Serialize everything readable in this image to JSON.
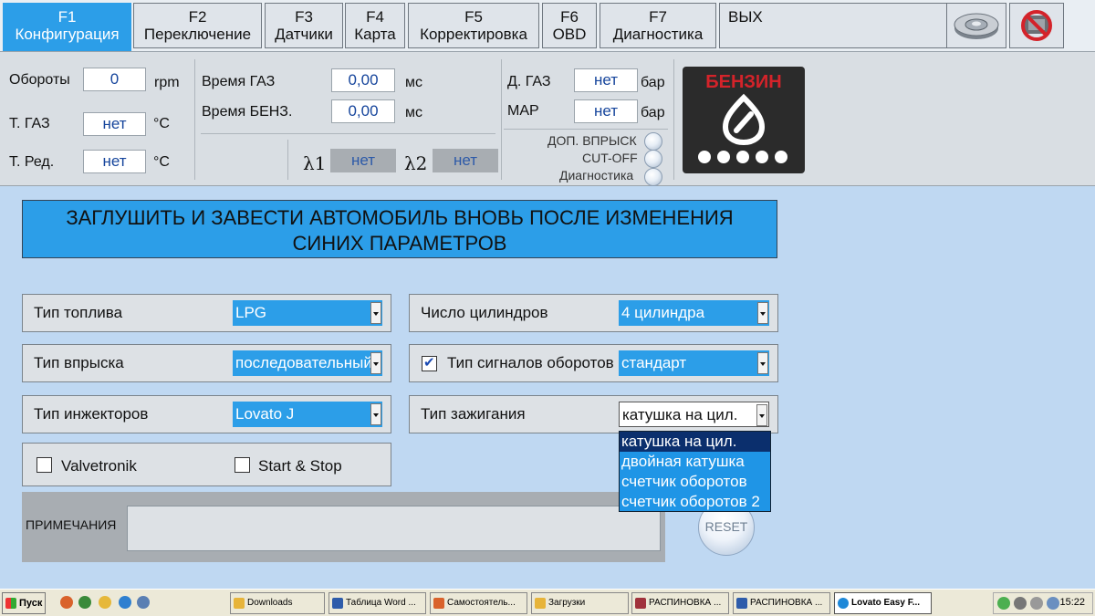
{
  "tabs": [
    {
      "key": "F1",
      "label": "Конфигурация"
    },
    {
      "key": "F2",
      "label": "Переключение"
    },
    {
      "key": "F3",
      "label": "Датчики"
    },
    {
      "key": "F4",
      "label": "Карта"
    },
    {
      "key": "F5",
      "label": "Корректировка"
    },
    {
      "key": "F6",
      "label": "OBD"
    },
    {
      "key": "F7",
      "label": "Диагностика"
    }
  ],
  "exit_label": "ВЫХ",
  "status": {
    "rpm_label": "Обороты",
    "rpm_value": "0",
    "rpm_unit": "rpm",
    "t_gas_label": "Т. ГАЗ",
    "t_gas_value": "нет",
    "t_gas_unit": "°C",
    "t_red_label": "Т. Ред.",
    "t_red_value": "нет",
    "t_red_unit": "°C",
    "time_gas_label": "Время ГАЗ",
    "time_gas_value": "0,00",
    "time_gas_unit": "мс",
    "time_benz_label": "Время БЕНЗ.",
    "time_benz_value": "0,00",
    "time_benz_unit": "мс",
    "lambda1_label": "λ1",
    "lambda1_value": "нет",
    "lambda2_label": "λ2",
    "lambda2_value": "нет",
    "d_gas_label": "Д. ГАЗ",
    "d_gas_value": "нет",
    "d_gas_unit": "бар",
    "map_label": "MAP",
    "map_value": "нет",
    "map_unit": "бар",
    "indicators": [
      "ДОП. ВПРЫСК",
      "CUT-OFF",
      "Диагностика"
    ],
    "fuel_mode": "БЕНЗИН"
  },
  "banner": {
    "line1": "ЗАГЛУШИТЬ И ЗАВЕСТИ АВТОМОБИЛЬ ВНОВЬ ПОСЛЕ ИЗМЕНЕНИЯ",
    "line2": "СИНИХ ПАРАМЕТРОВ"
  },
  "params": {
    "fuel_type_label": "Тип топлива",
    "fuel_type_value": "LPG",
    "injection_label": "Тип впрыска",
    "injection_value": "последовательный",
    "injectors_label": "Тип инжекторов",
    "injectors_value": "Lovato J",
    "cylinders_label": "Число цилиндров",
    "cylinders_value": "4 цилиндра",
    "rpm_signal_label": "Тип сигналов оборотов",
    "rpm_signal_value": "стандарт",
    "rpm_signal_checked": true,
    "ignition_label": "Тип зажигания",
    "ignition_value": "катушка на цил.",
    "ignition_options": [
      "катушка на цил.",
      "двойная катушка",
      "счетчик оборотов",
      "счетчик оборотов 2"
    ],
    "valvetronik_label": "Valvetronik",
    "valvetronik_checked": false,
    "startstop_label": "Start & Stop",
    "startstop_checked": false
  },
  "notes_label": "ПРИМЕЧАНИЯ",
  "reset_label": "RESET",
  "taskbar": {
    "start_label": "Пуск",
    "tasks": [
      {
        "label": "Downloads",
        "color": "#e7b43a"
      },
      {
        "label": "Таблица Word ...",
        "color": "#2e5caa"
      },
      {
        "label": "Самостоятель...",
        "color": "#d9622b"
      },
      {
        "label": "Загрузки",
        "color": "#e7b43a"
      },
      {
        "label": "РАСПИНОВКА ...",
        "color": "#a0323c"
      },
      {
        "label": "РАСПИНОВКА ...",
        "color": "#2e5caa"
      },
      {
        "label": "Lovato Easy F...",
        "color": "#1e88d8"
      }
    ],
    "clock": "15:22"
  }
}
